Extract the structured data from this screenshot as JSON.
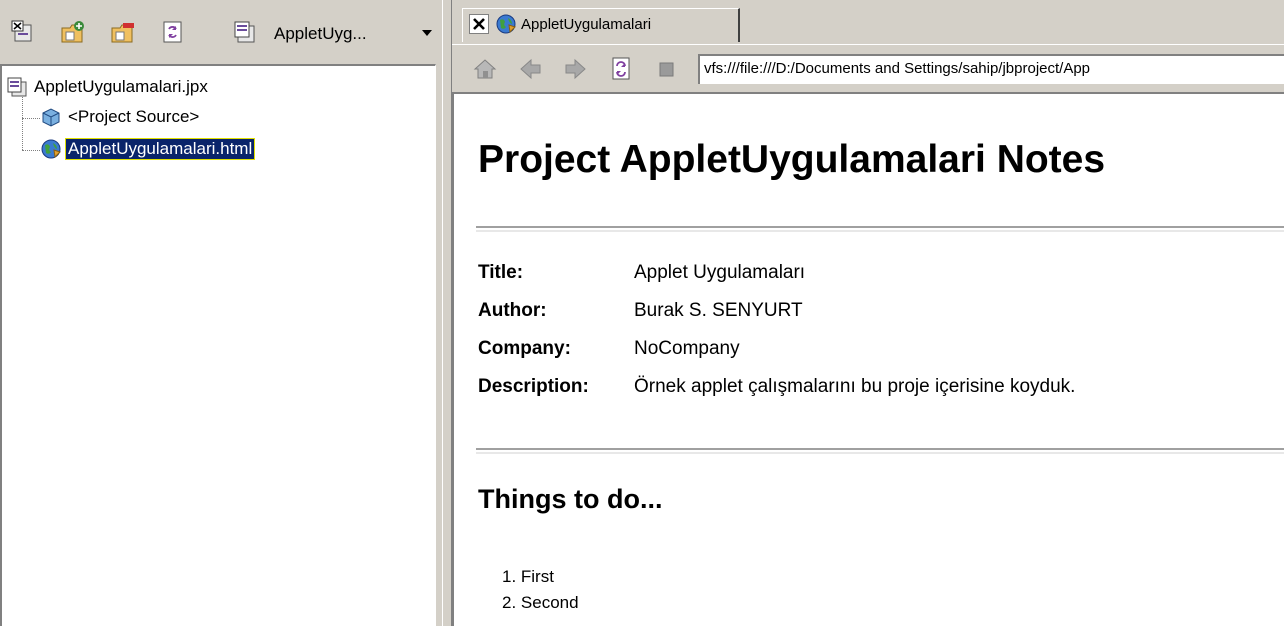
{
  "left_toolbar": {
    "buttons": [
      {
        "icon": "close-project-icon"
      },
      {
        "icon": "add-files-icon"
      },
      {
        "icon": "remove-files-icon"
      },
      {
        "icon": "refresh-icon"
      }
    ],
    "project_selector": {
      "value": "AppletUyg...",
      "icon": "project-icon"
    }
  },
  "tree": {
    "root": {
      "label": "AppletUygulamalari.jpx",
      "icon": "project-file-icon"
    },
    "children": [
      {
        "label": "<Project Source>",
        "icon": "package-icon"
      },
      {
        "label": "AppletUygulamalari.html",
        "icon": "html-globe-icon",
        "selected": true
      }
    ]
  },
  "tab": {
    "label": "AppletUygulamalari",
    "close_icon": "close-icon",
    "icon": "html-globe-icon"
  },
  "nav_toolbar": {
    "buttons": [
      "home-icon",
      "back-icon",
      "forward-icon",
      "refresh-icon",
      "stop-icon"
    ],
    "url": "vfs:///file:///D:/Documents and Settings/sahip/jbproject/App"
  },
  "page": {
    "heading": "Project AppletUygulamalari Notes",
    "meta": [
      {
        "key": "Title:",
        "value": "Applet Uygulamaları"
      },
      {
        "key": "Author:",
        "value": "Burak S. SENYURT"
      },
      {
        "key": "Company:",
        "value": "NoCompany"
      },
      {
        "key": "Description:",
        "value": "Örnek applet çalışmalarını bu proje içerisine koyduk."
      }
    ],
    "todo_heading": "Things to do...",
    "todo": [
      "1. First",
      "2. Second"
    ]
  },
  "colors": {
    "chrome": "#d4d0c8",
    "selection": "#0a246a",
    "selection_outline": "#e0e000"
  }
}
